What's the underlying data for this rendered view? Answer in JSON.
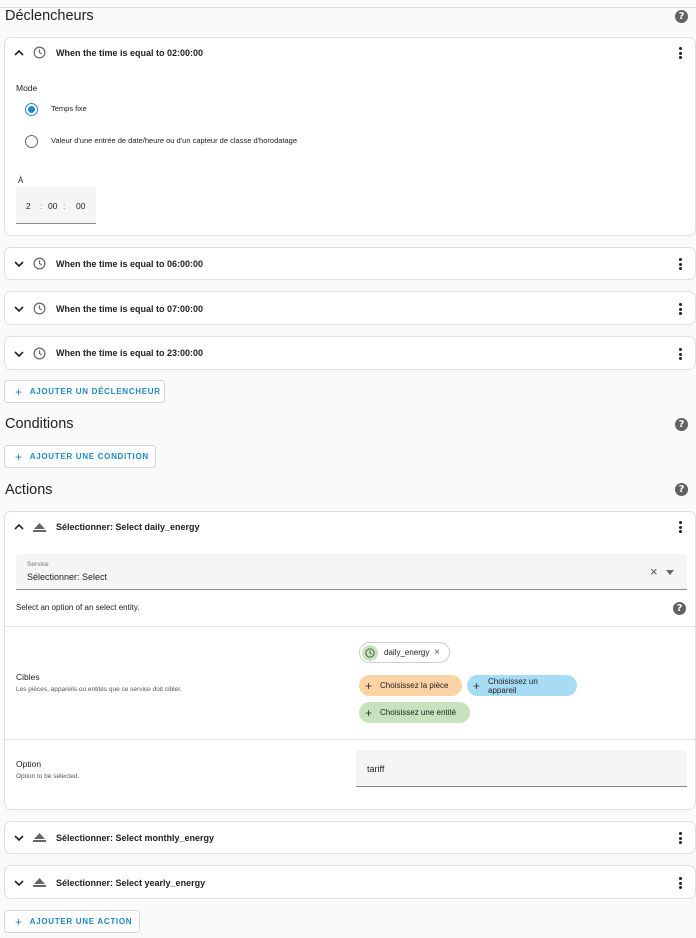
{
  "triggers": {
    "title": "Déclencheurs",
    "items": [
      {
        "title": "When the time is equal to 02:00:00"
      },
      {
        "title": "When the time is equal to 06:00:00"
      },
      {
        "title": "When the time is equal to 07:00:00"
      },
      {
        "title": "When the time is equal to 23:00:00"
      }
    ],
    "mode_label": "Mode",
    "mode_options": [
      "Temps fixe",
      "Valeur d'une entrée de date/heure ou d'un capteur de classe d'horodatage"
    ],
    "selected_mode": "Temps fixe",
    "at_label": "À",
    "time": {
      "h": "2",
      "m": "00",
      "s": "00",
      "sep": ":"
    },
    "add_button": "AJOUTER UN DÉCLENCHEUR"
  },
  "conditions": {
    "title": "Conditions",
    "add_button": "AJOUTER UNE CONDITION"
  },
  "actions": {
    "title": "Actions",
    "items": [
      {
        "title": "Sélectionner: Select daily_energy"
      },
      {
        "title": "Sélectionner: Select monthly_energy"
      },
      {
        "title": "Sélectionner: Select yearly_energy"
      }
    ],
    "service_label": "Service",
    "service_value": "Sélectionner: Select",
    "service_description": "Select an option of an select entity.",
    "targets_label": "Cibles",
    "targets_description": "Les pièces, appareils ou entités que ce service doit cibler.",
    "target_entity_chip": "daily_energy",
    "choose_area": "Choisissez la pièce",
    "choose_device": "Choisissez un appareil",
    "choose_entity": "Choisissez une entité",
    "option_label": "Option",
    "option_description": "Option to be selected.",
    "option_value": "tariff",
    "add_button": "AJOUTER UNE ACTION"
  },
  "colors": {
    "accent": "#1e88c8",
    "area_chip": "#fcd3a4",
    "device_chip": "#a8dcf5",
    "entity_chip": "#c7e3bd"
  }
}
